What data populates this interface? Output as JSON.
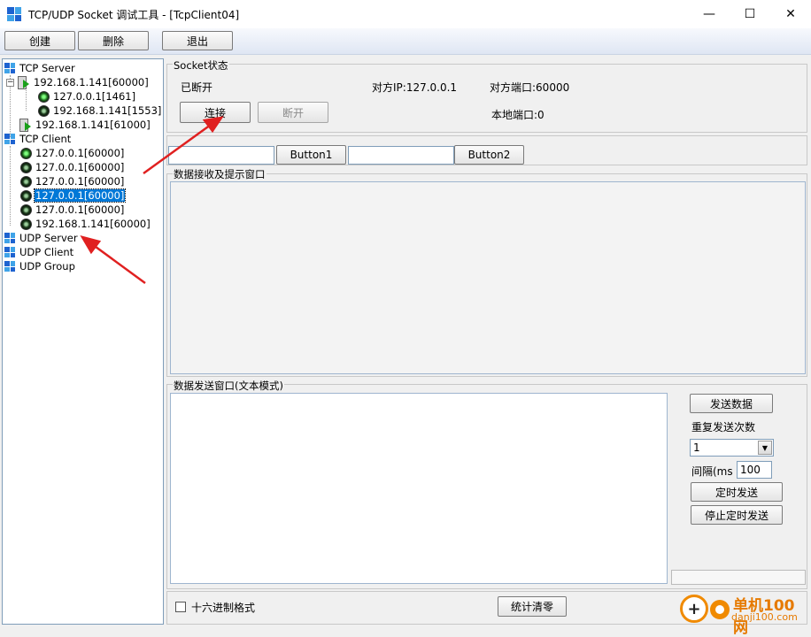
{
  "window": {
    "title": "TCP/UDP Socket 调试工具 - [TcpClient04]",
    "minimize_glyph": "—",
    "maximize_glyph": "☐",
    "close_glyph": "✕"
  },
  "toolbar": {
    "create_label": "创建",
    "delete_label": "删除",
    "exit_label": "退出"
  },
  "tree": {
    "tcp_server": "TCP Server",
    "tcp_server_children": [
      "192.168.1.141[60000]",
      "127.0.0.1[1461]",
      "192.168.1.141[1553]",
      "192.168.1.141[61000]"
    ],
    "tcp_client": "TCP Client",
    "tcp_client_children": [
      "127.0.0.1[60000]",
      "127.0.0.1[60000]",
      "127.0.0.1[60000]",
      "127.0.0.1[60000]",
      "127.0.0.1[60000]",
      "192.168.1.141[60000]"
    ],
    "udp_server": "UDP Server",
    "udp_client": "UDP Client",
    "udp_group": "UDP Group",
    "expander_glyph": "−"
  },
  "socket_status": {
    "group_title": "Socket状态",
    "state": "已断开",
    "remote_ip": "对方IP:127.0.0.1",
    "remote_port": "对方端口:60000",
    "local_port": "本地端口:0",
    "connect_label": "连接",
    "disconnect_label": "断开"
  },
  "custom": {
    "button1_label": "Button1",
    "button2_label": "Button2",
    "input1_value": "",
    "input2_value": ""
  },
  "receive": {
    "group_title": "数据接收及提示窗口"
  },
  "send": {
    "group_title": "数据发送窗口(文本模式)",
    "send_label": "发送数据",
    "repeat_label": "重复发送次数",
    "repeat_value": "1",
    "interval_label": "间隔(ms",
    "interval_value": "100",
    "timer_send_label": "定时发送",
    "stop_timer_label": "停止定时发送"
  },
  "footer": {
    "hex_label": "十六进制格式",
    "reset_label": "统计清零"
  },
  "watermark": {
    "logo_glyph": "+",
    "name": "单机100网",
    "url": "danji100.com"
  },
  "colors": {
    "accent": "#f08a00",
    "selection": "#0078d7",
    "arrow": "#e02020"
  }
}
